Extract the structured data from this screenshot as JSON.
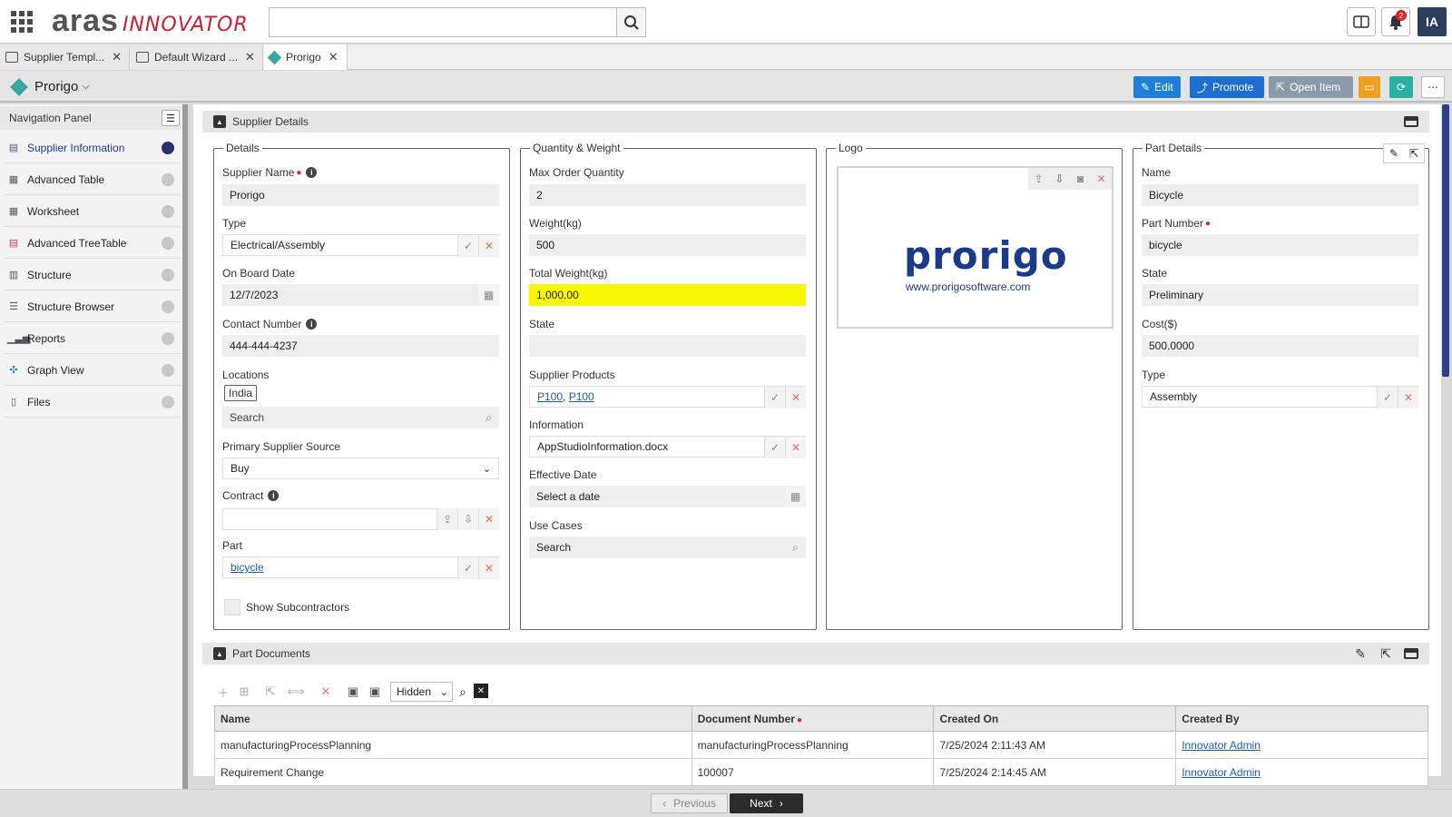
{
  "app": {
    "logo_main": "aras",
    "logo_sub": "INNOVATOR",
    "user_initials": "IA",
    "notification_count": "2"
  },
  "tabs": [
    {
      "label": "Supplier Templ..."
    },
    {
      "label": "Default Wizard ..."
    },
    {
      "label": "Prorigo"
    }
  ],
  "item": {
    "title": "Prorigo"
  },
  "actions": {
    "edit": "Edit",
    "promote": "Promote",
    "open_item": "Open Item"
  },
  "nav": {
    "title": "Navigation Panel",
    "items": [
      {
        "label": "Supplier Information"
      },
      {
        "label": "Advanced Table"
      },
      {
        "label": "Worksheet"
      },
      {
        "label": "Advanced TreeTable"
      },
      {
        "label": "Structure"
      },
      {
        "label": "Structure Browser"
      },
      {
        "label": "Reports"
      },
      {
        "label": "Graph View"
      },
      {
        "label": "Files"
      }
    ]
  },
  "supplier_details": {
    "section_title": "Supplier Details",
    "details": {
      "legend": "Details",
      "supplier_name_label": "Supplier Name",
      "supplier_name": "Prorigo",
      "type_label": "Type",
      "type": "Electrical/Assembly",
      "on_board_label": "On Board Date",
      "on_board": "12/7/2023",
      "contact_label": "Contact Number",
      "contact": "444-444-4237",
      "locations_label": "Locations",
      "location_chip": "India",
      "locations_search": "Search",
      "source_label": "Primary Supplier Source",
      "source": "Buy",
      "contract_label": "Contract",
      "part_label": "Part",
      "part": "bicycle",
      "subcontractors_label": "Show Subcontractors"
    },
    "quantity": {
      "legend": "Quantity & Weight",
      "max_order_label": "Max Order Quantity",
      "max_order": "2",
      "weight_label": "Weight(kg)",
      "weight": "500",
      "total_weight_label": "Total Weight(kg)",
      "total_weight": "1,000.00",
      "state_label": "State",
      "state": "",
      "products_label": "Supplier Products",
      "product_1": "P100",
      "product_sep": ", ",
      "product_2": "P100",
      "information_label": "Information",
      "information": "AppStudioInformation.docx",
      "effective_label": "Effective Date",
      "effective_placeholder": "Select a date",
      "use_cases_label": "Use Cases",
      "use_cases_search": "Search"
    },
    "logo": {
      "legend": "Logo",
      "brand": "prorigo",
      "url": "www.prorigosoftware.com"
    },
    "part_details": {
      "legend": "Part Details",
      "name_label": "Name",
      "name": "Bicycle",
      "number_label": "Part Number",
      "number": "bicycle",
      "state_label": "State",
      "state": "Preliminary",
      "cost_label": "Cost($)",
      "cost": "500.0000",
      "type_label": "Type",
      "type": "Assembly"
    }
  },
  "part_documents": {
    "section_title": "Part Documents",
    "filter": "Hidden",
    "columns": [
      "Name",
      "Document Number",
      "Created On",
      "Created By"
    ],
    "rows": [
      [
        "manufacturingProcessPlanning",
        "manufacturingProcessPlanning",
        "7/25/2024 2:11:43 AM",
        "Innovator Admin"
      ],
      [
        "Requirement Change",
        "100007",
        "7/25/2024 2:14:45 AM",
        "Innovator Admin"
      ]
    ]
  },
  "footer": {
    "previous": "Previous",
    "next": "Next"
  },
  "colors": {
    "edit": "#1f7fd6",
    "promote": "#1c6fd1",
    "open_item": "#8a9aa8",
    "comment": "#f0a020",
    "refresh": "#2ab0a0",
    "active_dot": "#27306b",
    "highlight": "#f9f700"
  }
}
